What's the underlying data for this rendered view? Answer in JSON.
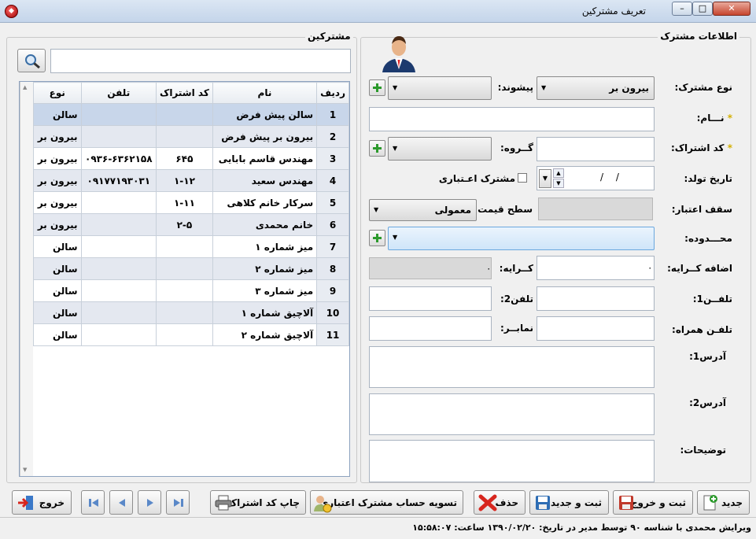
{
  "window": {
    "title": "تعريف مشتركين"
  },
  "info_group": {
    "title": "اطلاعات مشترک",
    "customer_type_label": "نوع مشترک:",
    "customer_type_value": "بيرون بر",
    "prefix_label": "پيشوند:",
    "name_label": "نـــام:",
    "code_label": "کد اشتراک:",
    "group_label": "گــروه:",
    "birth_label": "تاريخ تولد:",
    "birth_value": "/  /",
    "credit_check_label": "مشترک اعـتباری",
    "credit_limit_label": "سقف اعتبار:",
    "price_level_label": "سطح قيمت:",
    "price_level_value": "معمولی",
    "region_label": "محـــدوده:",
    "extra_rent_label": "اضافه کــرايه:",
    "extra_rent_value": "۰",
    "rent_label": "کــرايه:",
    "rent_value": "۰",
    "phone1_label": "تلفــن1:",
    "phone2_label": "تلفن2:",
    "mobile_label": "تلفـن همراه:",
    "fax_label": "نمابــر:",
    "address1_label": "آدرس1:",
    "address2_label": "آدرس2:",
    "notes_label": "توضيحات:"
  },
  "customers_group": {
    "title": "مشترکين",
    "search_value": "",
    "columns": [
      "رديف",
      "نام",
      "کد اشتراک",
      "تلفن",
      "نوع"
    ],
    "rows": [
      {
        "n": "1",
        "name": "سالن پيش فرض",
        "code": "",
        "phone": "",
        "type": "سالن"
      },
      {
        "n": "2",
        "name": "بيرون بر پيش فرض",
        "code": "",
        "phone": "",
        "type": "بيرون بر"
      },
      {
        "n": "3",
        "name": "مهندس قاسم بابايی",
        "code": "۶۴۵",
        "phone": "۰۹۳۶-۶۳۶۲۱۵۸",
        "type": "بيرون بر"
      },
      {
        "n": "4",
        "name": "مهندس سعيد",
        "code": "۱-۱۲",
        "phone": "۰۹۱۷۷۱۹۳۰۳۱",
        "type": "بيرون بر"
      },
      {
        "n": "5",
        "name": "سرکار خانم کلاهی",
        "code": "۱-۱۱",
        "phone": "",
        "type": "بيرون بر"
      },
      {
        "n": "6",
        "name": "خانم محمدی",
        "code": "۲-۵",
        "phone": "",
        "type": "بيرون بر"
      },
      {
        "n": "7",
        "name": "ميز شماره ۱",
        "code": "",
        "phone": "",
        "type": "سالن"
      },
      {
        "n": "8",
        "name": "ميز شماره ۲",
        "code": "",
        "phone": "",
        "type": "سالن"
      },
      {
        "n": "9",
        "name": "ميز شماره ۳",
        "code": "",
        "phone": "",
        "type": "سالن"
      },
      {
        "n": "10",
        "name": "آلاچيق شماره ۱",
        "code": "",
        "phone": "",
        "type": "سالن"
      },
      {
        "n": "11",
        "name": "آلاچيق شماره ۲",
        "code": "",
        "phone": "",
        "type": "سالن"
      }
    ]
  },
  "toolbar": {
    "new": "جديد",
    "save_exit": "ثبت و خروج",
    "save_new": "ثبت و جديد",
    "delete": "حذف",
    "settle": "تسويه حساب مشترک اعتباری",
    "print_code": "چاپ کد اشتراک",
    "exit": "خروج"
  },
  "status": {
    "text": "ويرايش محمدی با شناسه ۹۰ توسط مدير در تاريخ: ۱۳۹۰/۰۲/۲۰ ساعت: ۱۵:۵۸:۰۷"
  }
}
